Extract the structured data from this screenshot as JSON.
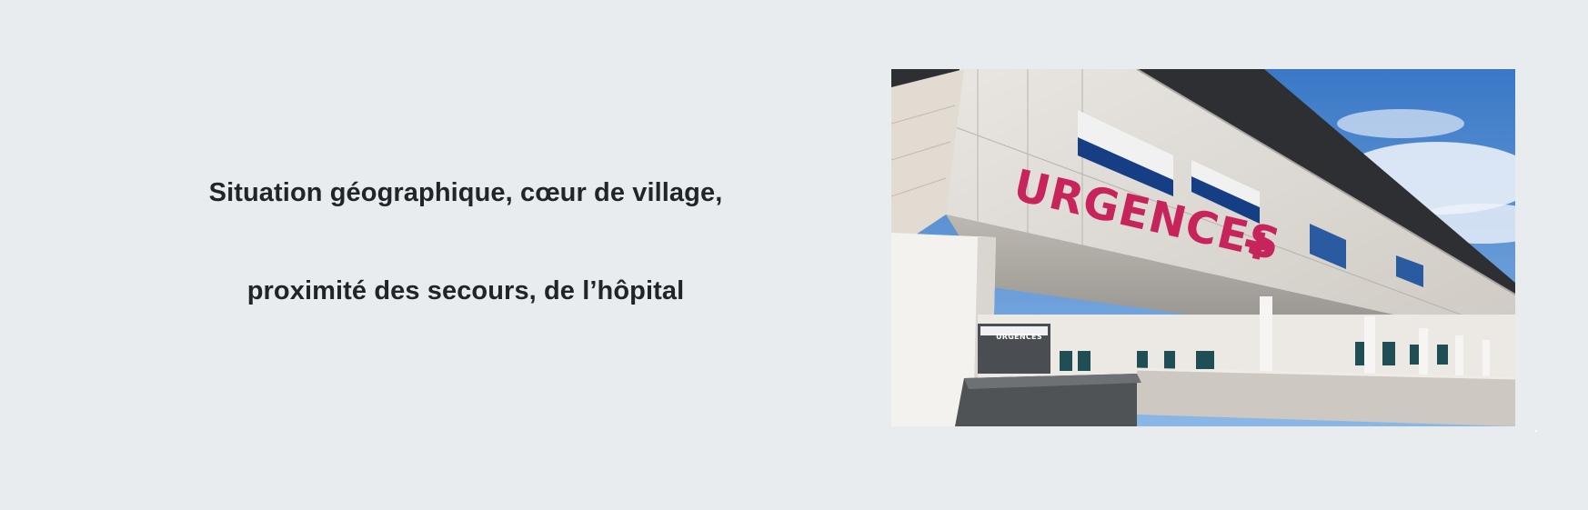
{
  "content": {
    "line1": "Situation géographique, cœur de village,",
    "line2": "proximité des secours, de l’hôpital"
  },
  "photo": {
    "main_sign": "URGENCES",
    "small_sign": "URGENCES"
  },
  "colors": {
    "background": "#e9ecef",
    "text": "#212529",
    "sign_magenta": "#c8245c"
  },
  "icons": {
    "cross": "medical-cross-icon"
  }
}
